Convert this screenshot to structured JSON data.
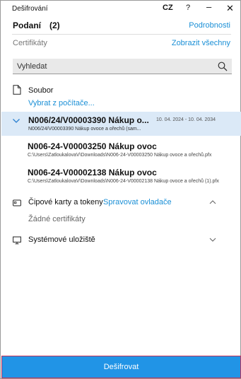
{
  "window": {
    "title": "Dešifrování",
    "language": "CZ",
    "help": "?",
    "minimize": "–",
    "close": "✕"
  },
  "header": {
    "title": "Podaní",
    "count": "(2)",
    "details_link": "Podrobnosti"
  },
  "certificates": {
    "label": "Certifikáty",
    "show_all_link": "Zobrazit všechny"
  },
  "search": {
    "placeholder": "Vyhledat"
  },
  "file": {
    "label": "Soubor",
    "pick_link": "Vybrat z počítače..."
  },
  "selected_cert": {
    "name": "N006/24/V00003390 Nákup o...",
    "dates": "10. 04. 2024 - 10. 04. 2034",
    "sub": "N006/24/V00003390 Nákup ovoce a ořechů (sam..."
  },
  "cert_items": [
    {
      "name": "N006-24-V00003250 Nákup ovoc",
      "path": "C:\\Users\\ZatloukalovaV\\Downloads\\N006-24-V00003250 Nákup ovoce a ořechů.pfx"
    },
    {
      "name": "N006-24-V00002138 Nákup ovoc",
      "path": "C:\\Users\\ZatloukalovaV\\Downloads\\N006-24-V00002138 Nákup ovoce a ořechů (1).pfx"
    }
  ],
  "smart_cards": {
    "label": "Čipové karty a tokeny",
    "manage_link": "Spravovat ovladače",
    "empty": "Žádné certifikáty"
  },
  "system_store": {
    "label": "Systémové uložiště"
  },
  "actions": {
    "decrypt": "Dešifrovat"
  },
  "colors": {
    "accent": "#1a8fd6",
    "primary_button": "#2194e6",
    "selected_row": "#dbe9f7"
  }
}
